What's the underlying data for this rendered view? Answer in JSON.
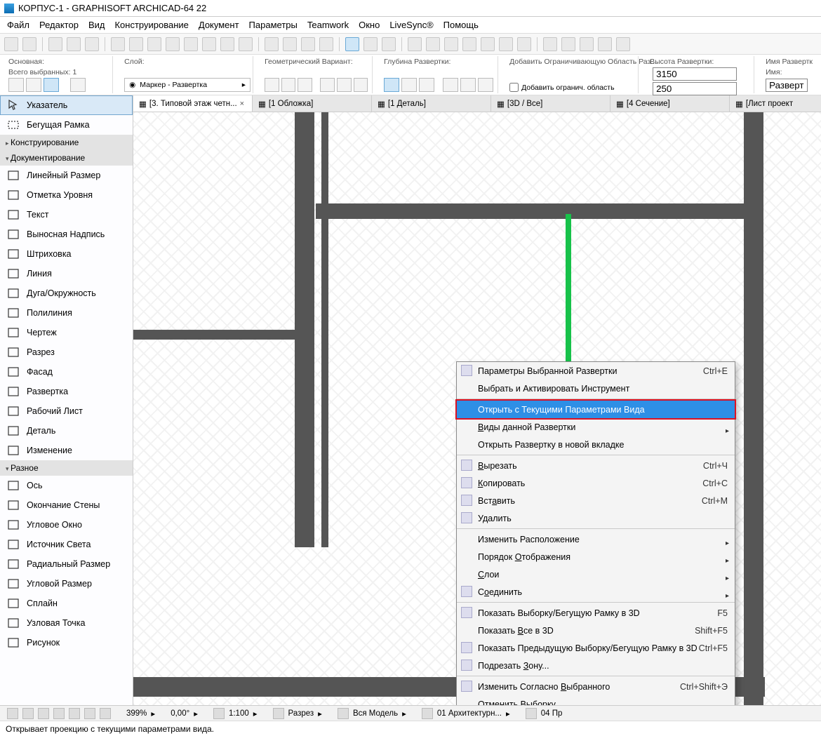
{
  "title": "КОРПУС-1 - GRAPHISOFT ARCHICAD-64 22",
  "menus": [
    "Файл",
    "Редактор",
    "Вид",
    "Конструирование",
    "Документ",
    "Параметры",
    "Teamwork",
    "Окно",
    "LiveSync®",
    "Помощь"
  ],
  "infobox": {
    "section_main": "Основная:",
    "selected_count_label": "Всего выбранных: 1",
    "layer_label": "Слой:",
    "layer_value": "Маркер - Развертка",
    "geom_label": "Геометрический Вариант:",
    "depth_label": "Глубина Развертки:",
    "bounds_label": "Добавить Ограничивающую Область Раз...",
    "bounds_checkbox": "Добавить огранич. область",
    "height_label": "Высота Развертки:",
    "height_top": "3150",
    "height_bot": "250",
    "name_section": "Имя Развертк",
    "name_label": "Имя:",
    "name_value": "Развертк"
  },
  "toolbox": {
    "pointer": "Указатель",
    "marquee": "Бегущая Рамка",
    "h_constr": "Конструирование",
    "h_doc": "Документирование",
    "items_doc": [
      "Линейный Размер",
      "Отметка Уровня",
      "Текст",
      "Выносная Надпись",
      "Штриховка",
      "Линия",
      "Дуга/Окружность",
      "Полилиния",
      "Чертеж",
      "Разрез",
      "Фасад",
      "Развертка",
      "Рабочий Лист",
      "Деталь",
      "Изменение"
    ],
    "h_misc": "Разное",
    "items_misc": [
      "Ось",
      "Окончание Стены",
      "Угловое Окно",
      "Источник Света",
      "Радиальный Размер",
      "Угловой Размер",
      "Сплайн",
      "Узловая Точка",
      "Рисунок"
    ]
  },
  "tabs": [
    {
      "label": "[3. Типовой этаж четн...",
      "close": true,
      "active": true
    },
    {
      "label": "[1 Обложка]"
    },
    {
      "label": "[1 Деталь]"
    },
    {
      "label": "[3D / Все]"
    },
    {
      "label": "[4 Сечение]"
    },
    {
      "label": "[Лист проект"
    }
  ],
  "context_menu": [
    {
      "label": "Параметры Выбранной Развертки",
      "shortcut": "Ctrl+E",
      "icon": "settings-icon"
    },
    {
      "label": "Выбрать и Активировать Инструмент"
    },
    {
      "sep": true
    },
    {
      "label": "Открыть с Текущими Параметрами Вида",
      "highlight": true
    },
    {
      "label": "Виды данной Развертки",
      "submenu": true,
      "underline": [
        0
      ]
    },
    {
      "label": "Открыть Развертку в новой вкладке"
    },
    {
      "sep": true
    },
    {
      "label": "Вырезать",
      "shortcut": "Ctrl+Ч",
      "icon": "cut-icon",
      "underline": [
        0
      ]
    },
    {
      "label": "Копировать",
      "shortcut": "Ctrl+C",
      "icon": "copy-icon",
      "underline": [
        0
      ]
    },
    {
      "label": "Вставить",
      "shortcut": "Ctrl+M",
      "icon": "paste-icon",
      "underline": [
        3
      ]
    },
    {
      "label": "Удалить",
      "icon": "delete-icon"
    },
    {
      "sep": true
    },
    {
      "label": "Изменить Расположение",
      "submenu": true
    },
    {
      "label": "Порядок Отображения",
      "submenu": true,
      "underline": [
        8
      ]
    },
    {
      "label": "Слои",
      "submenu": true,
      "underline": [
        0
      ]
    },
    {
      "label": "Соединить",
      "submenu": true,
      "underline": [
        1
      ],
      "icon": "connect-icon"
    },
    {
      "sep": true
    },
    {
      "label": "Показать Выборку/Бегущую Рамку в 3D",
      "shortcut": "F5",
      "icon": "show3d-icon"
    },
    {
      "label": "Показать Все в 3D",
      "shortcut": "Shift+F5",
      "underline": [
        9
      ]
    },
    {
      "label": "Показать Предыдущую Выборку/Бегущую Рамку в 3D",
      "shortcut": "Ctrl+F5",
      "icon": "prev3d-icon"
    },
    {
      "label": "Подрезать Зону...",
      "icon": "trimzone-icon",
      "underline": [
        10
      ]
    },
    {
      "sep": true
    },
    {
      "label": "Изменить Согласно Выбранного",
      "shortcut": "Ctrl+Shift+Э",
      "underline": [
        18
      ],
      "icon": "modify-icon"
    },
    {
      "label": "Отменить Выборку"
    }
  ],
  "status": {
    "zoom": "399%",
    "angle": "0,00°",
    "scale": "1:100",
    "mode": "Разрез",
    "model": "Вся Модель",
    "layercombo": "01 Архитектурн...",
    "sheet": "04 Пр"
  },
  "hint": "Открывает проекцию с текущими параметрами вида."
}
